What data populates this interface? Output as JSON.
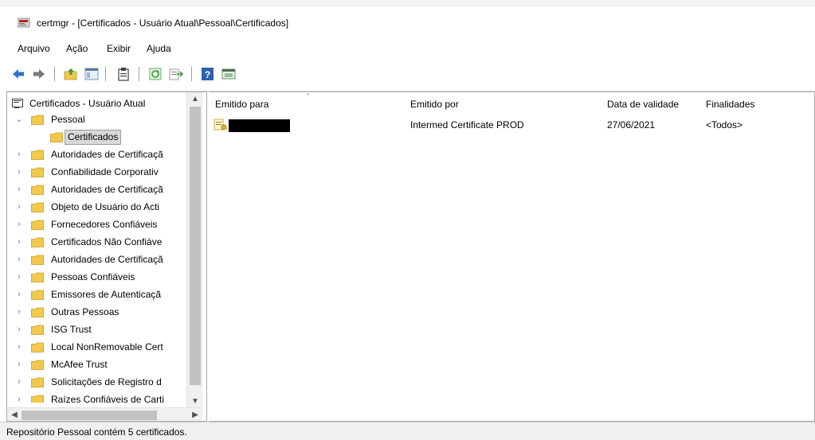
{
  "window": {
    "title": "certmgr - [Certificados - Usuário Atual\\Pessoal\\Certificados]"
  },
  "menu": {
    "items": [
      "Arquivo",
      "Ação",
      "Exibir",
      "Ajuda"
    ]
  },
  "toolbar": {
    "icons": [
      "back-arrow-icon",
      "forward-arrow-icon",
      "up-folder-icon",
      "show-hide-tree-icon",
      "clipboard-icon",
      "refresh-icon",
      "export-list-icon",
      "help-icon",
      "console-view-icon"
    ]
  },
  "tree": {
    "root": "Certificados - Usuário Atual",
    "items": [
      {
        "label": "Pessoal",
        "expanded": true
      },
      {
        "label": "Certificados",
        "selected": true
      },
      {
        "label": "Autoridades de Certificaçã"
      },
      {
        "label": "Confiabilidade Corporativ"
      },
      {
        "label": "Autoridades de Certificaçã"
      },
      {
        "label": "Objeto de Usuário do Acti"
      },
      {
        "label": "Fornecedores Confiáveis"
      },
      {
        "label": "Certificados Não Confiáve"
      },
      {
        "label": "Autoridades de Certificaçã"
      },
      {
        "label": "Pessoas Confiáveis"
      },
      {
        "label": "Emissores de Autenticaçã"
      },
      {
        "label": "Outras Pessoas"
      },
      {
        "label": "ISG Trust"
      },
      {
        "label": "Local NonRemovable Cert"
      },
      {
        "label": "McAfee Trust"
      },
      {
        "label": "Solicitações de Registro d"
      },
      {
        "label": "Raízes Confiáveis de Carti"
      }
    ]
  },
  "list": {
    "columns": [
      "Emitido para",
      "Emitido por",
      "Data de validade",
      "Finalidades"
    ],
    "rows": [
      {
        "issued_to": "",
        "issued_by": "Intermed Certificate PROD",
        "expiration": "27/06/2021",
        "purposes": "<Todos>"
      }
    ]
  },
  "status": {
    "text": "Repositório Pessoal contém 5 certificados."
  },
  "colors": {
    "folder": "#f2c94c",
    "selection": "#d9d9d9",
    "arrow_blue": "#2f73c7"
  }
}
